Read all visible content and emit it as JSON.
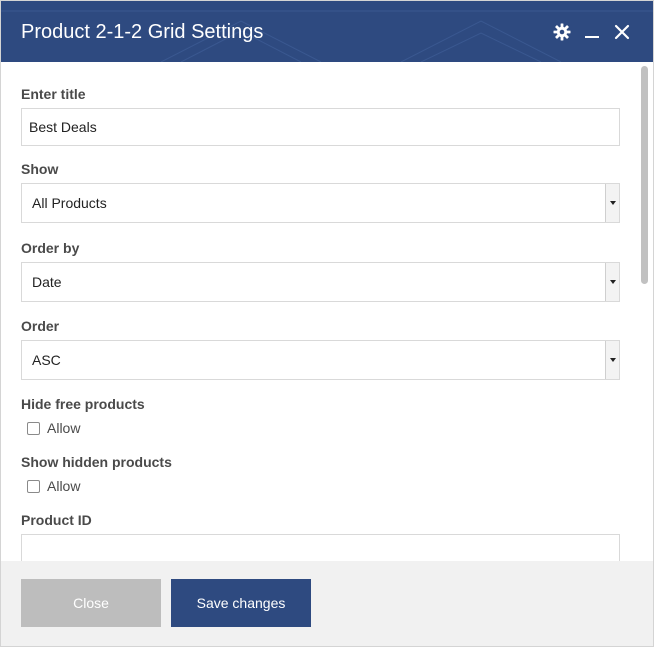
{
  "dialog": {
    "title": "Product 2-1-2 Grid Settings",
    "icons": [
      "gear-icon",
      "minimize-icon",
      "close-icon"
    ]
  },
  "form": {
    "title_label": "Enter title",
    "title_value": "Best Deals",
    "show_label": "Show",
    "show_value": "All Products",
    "orderby_label": "Order by",
    "orderby_value": "Date",
    "order_label": "Order",
    "order_value": "ASC",
    "hide_free_label": "Hide free products",
    "hide_free_option": "Allow",
    "show_hidden_label": "Show hidden products",
    "show_hidden_option": "Allow",
    "product_id_label": "Product ID",
    "product_id_value": ""
  },
  "footer": {
    "close_label": "Close",
    "save_label": "Save changes"
  },
  "colors": {
    "header": "#2e4a80",
    "primary_button": "#2e4a80",
    "disabled_button": "#bdbdbd",
    "footer_bg": "#f1f1f1"
  }
}
